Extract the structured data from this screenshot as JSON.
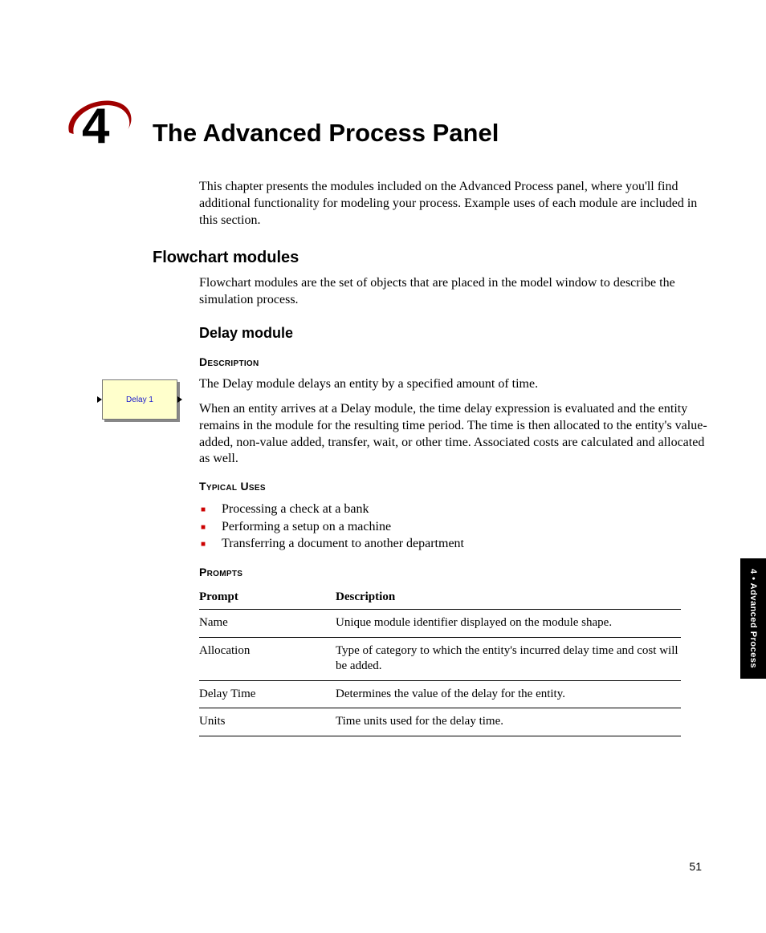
{
  "chapter": {
    "number": "4",
    "title": "The Advanced Process Panel",
    "intro": "This chapter presents the modules included on the Advanced Process panel, where you'll find additional functionality for modeling your process. Example uses of each module are included in this section."
  },
  "flowchart": {
    "heading": "Flowchart modules",
    "body": "Flowchart modules are the set of objects that are placed in the model window to describe the simulation process."
  },
  "delay": {
    "heading": "Delay module",
    "figure_label": "Delay 1",
    "description_heading": "Description",
    "description_p1": "The Delay module delays an entity by a specified amount of time.",
    "description_p2": "When an entity arrives at a Delay module, the time delay expression is evaluated and the entity remains in the module for the resulting time period. The time is then allocated to the entity's value-added, non-value added, transfer, wait, or other time. Associated costs are calculated and allocated as well.",
    "uses_heading": "Typical Uses",
    "uses": [
      "Processing a check at a bank",
      "Performing a setup on a machine",
      "Transferring a document to another department"
    ],
    "prompts_heading": "Prompts",
    "prompts_table": {
      "headers": {
        "prompt": "Prompt",
        "description": "Description"
      },
      "rows": [
        {
          "prompt": "Name",
          "description": "Unique module identifier displayed on the module shape."
        },
        {
          "prompt": "Allocation",
          "description": "Type of category to which the entity's incurred delay time and cost will be added."
        },
        {
          "prompt": "Delay Time",
          "description": "Determines the value of the delay for the entity."
        },
        {
          "prompt": "Units",
          "description": "Time units used for the delay time."
        }
      ]
    }
  },
  "side_tab": "4 • Advanced Process",
  "page_number": "51"
}
